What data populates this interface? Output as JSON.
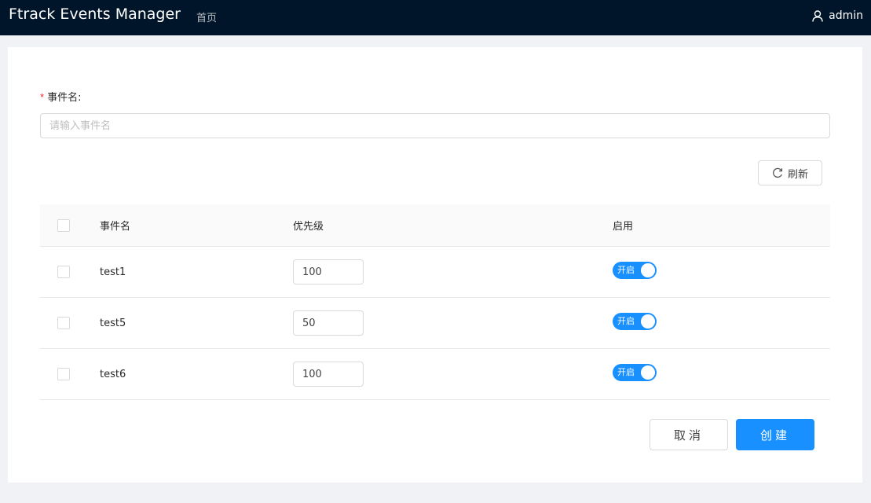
{
  "header": {
    "title": "Ftrack Events Manager",
    "nav": [
      {
        "label": "首页"
      }
    ],
    "user": {
      "name": "admin",
      "icon": "user-icon"
    }
  },
  "form": {
    "label": "事件名:",
    "required_mark": "*",
    "input": {
      "value": "",
      "placeholder": "请输入事件名"
    }
  },
  "toolbar": {
    "refresh_label": "刷新",
    "refresh_icon": "reload-icon"
  },
  "table": {
    "columns": [
      "事件名",
      "优先级",
      "启用"
    ],
    "rows": [
      {
        "name": "test1",
        "priority": "100",
        "enabled": true,
        "switch_label": "开启"
      },
      {
        "name": "test5",
        "priority": "50",
        "enabled": true,
        "switch_label": "开启"
      },
      {
        "name": "test6",
        "priority": "100",
        "enabled": true,
        "switch_label": "开启"
      }
    ]
  },
  "actions": {
    "cancel_label": "取消",
    "create_label": "创建"
  },
  "colors": {
    "header_bg": "#001529",
    "primary": "#1890ff",
    "page_bg": "#f0f2f5"
  }
}
